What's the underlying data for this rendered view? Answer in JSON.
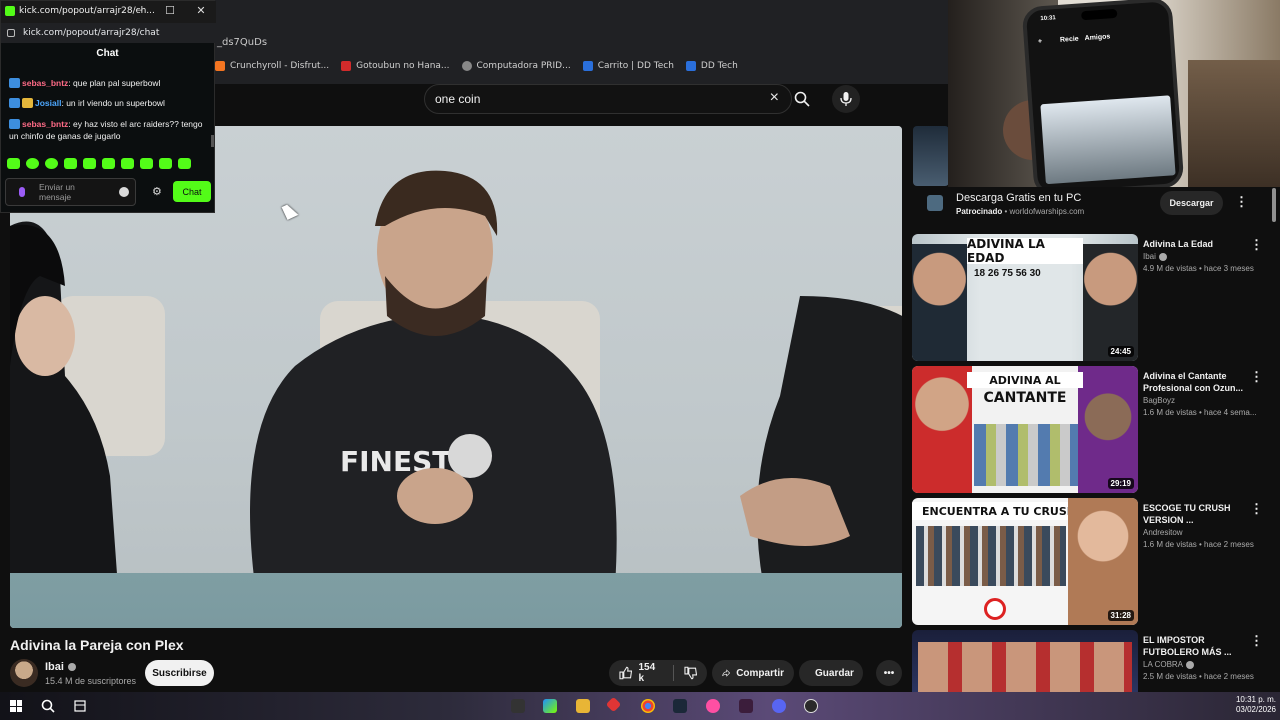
{
  "browser": {
    "url_fragment": "_ds7QuDs",
    "bookmarks": [
      {
        "label": "Crunchyroll - Disfrut...",
        "color": "#f47521"
      },
      {
        "label": "Gotoubun no Hana...",
        "color": "#d12b2b"
      },
      {
        "label": "Computadora PRID...",
        "color": "#888888"
      },
      {
        "label": "Carrito | DD Tech",
        "color": "#2a6fdb"
      },
      {
        "label": "DD Tech",
        "color": "#2a6fdb"
      }
    ]
  },
  "search": {
    "query": "one coin",
    "clear_icon": "×"
  },
  "video": {
    "title": "Adivina la Pareja con Plex",
    "channel": "Ibai",
    "subscribers": "15.4 M de suscriptores",
    "subscribe_label": "Suscribirse",
    "likes": "154 k",
    "share_label": "Compartir",
    "save_label": "Guardar"
  },
  "ad": {
    "title": "Descarga Gratis en tu PC",
    "sponsored": "Patrocinado",
    "domain": "worldofwarships.com",
    "cta": "Descargar"
  },
  "recommendations": [
    {
      "title": "Adivina La Edad",
      "channel": "Ibai",
      "meta": "4.9 M de vistas • hace 3 meses",
      "duration": "24:45",
      "banner": "ADIVINA LA EDAD",
      "numbers": "18  26  75  56  30"
    },
    {
      "title": "Adivina el Cantante Profesional con Ozun...",
      "channel": "BagBoyz",
      "meta": "1.6 M de vistas • hace 4 sema...",
      "duration": "29:19",
      "banner": "ADIVINA AL",
      "banner2": "CANTANTE"
    },
    {
      "title": "ESCOGE TU CRUSH VERSION ...",
      "channel": "Andresitow",
      "meta": "1.6 M de vistas • hace 2 meses",
      "duration": "31:28",
      "banner": "ENCUENTRA A TU CRUSH"
    },
    {
      "title": "EL IMPOSTOR FUTBOLERO MÁS ...",
      "channel": "LA COBRA",
      "meta": "2.5 M de vistas • hace 2 meses",
      "duration": ""
    }
  ],
  "phone": {
    "time": "10:31",
    "tab1": "Recie",
    "tab2": "Amigos"
  },
  "kick": {
    "window_title": "kick.com/popout/arrajr28/ch...",
    "url": "kick.com/popout/arrajr28/chat",
    "header": "Chat",
    "messages": [
      {
        "user": "sebas_bntz",
        "color": "pink",
        "text": ": que plan pal superbowl"
      },
      {
        "user": "Josiall",
        "color": "blue",
        "text": ": un irl viendo un superbowl"
      },
      {
        "user": "sebas_bntz",
        "color": "pink",
        "text": ": ey haz visto el arc raiders?? tengo un chinfo de ganas de jugarlo"
      }
    ],
    "input_placeholder": "Enviar un mensaje",
    "send_label": "Chat"
  },
  "taskbar": {
    "time": "10:31 p. m.",
    "date": "03/02/2026"
  },
  "colors": {
    "kick_green": "#53fc18",
    "yt_bg": "#0f0f0f"
  }
}
